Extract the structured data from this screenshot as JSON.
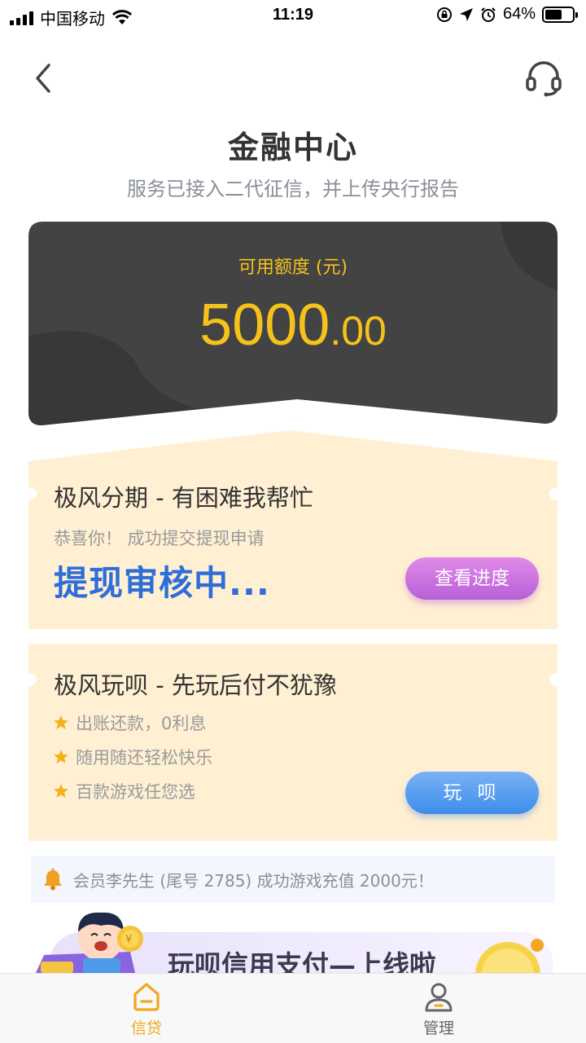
{
  "status_bar": {
    "carrier": "中国移动",
    "time": "11:19",
    "battery": "64%",
    "battery_level": 0.64
  },
  "header": {
    "title": "金融中心",
    "subtitle": "服务已接入二代征信，并上传央行报告"
  },
  "credit": {
    "label": "可用额度 (元)",
    "amount_int": "5000",
    "amount_dec": ".00",
    "text_color": "#f5c21b"
  },
  "installment_card": {
    "title": "极风分期 - 有困难我帮忙",
    "message": "恭喜你！ 成功提交提现申请",
    "status": "提现审核中...",
    "button": "查看进度"
  },
  "play_card": {
    "title": "极风玩呗 - 先玩后付不犹豫",
    "features": [
      "出账还款，0利息",
      "随用随还轻松快乐",
      "百款游戏任您选"
    ],
    "button": "玩 呗"
  },
  "notice": {
    "text": "会员李先生 (尾号 2785) 成功游戏充值 2000元！"
  },
  "banner": {
    "text": "玩呗信用支付—上线啦"
  },
  "tabs": [
    {
      "label": "信贷",
      "icon": "home-icon",
      "active": true
    },
    {
      "label": "管理",
      "icon": "user-icon",
      "active": false
    }
  ],
  "colors": {
    "accent": "#f0a81e",
    "card_dark": "#434343",
    "ticket_bg": "#fff0d4",
    "status_blue": "#2e6ed8",
    "button_purple": "#c56fdf",
    "button_blue": "#4f97ef"
  }
}
